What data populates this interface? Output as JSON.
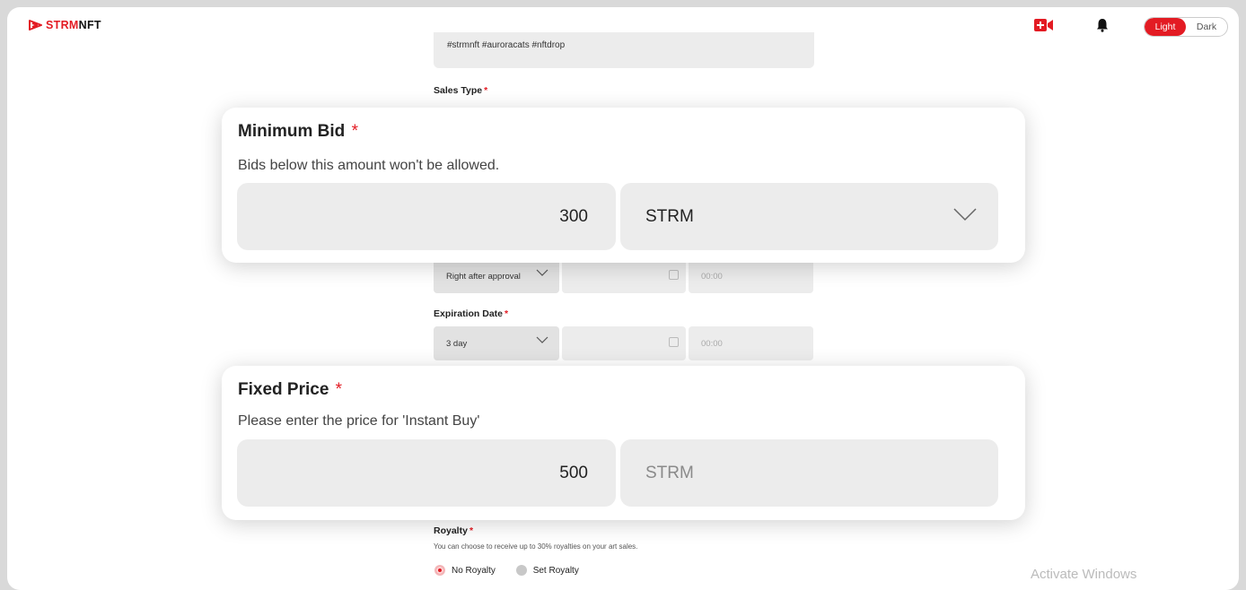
{
  "header": {
    "logo_text_a": "STRM",
    "logo_text_b": "NFT",
    "theme_light": "Light",
    "theme_dark": "Dark"
  },
  "form": {
    "tags_value": "#strmnft #auroracats #nftdrop",
    "sales_type_label": "Sales Type",
    "start_select": "Right after approval",
    "start_time": "00:00",
    "expiration_label": "Expiration Date",
    "expiration_select": "3 day",
    "expiration_time": "00:00",
    "royalty_label": "Royalty",
    "royalty_desc": "You can choose to receive up to 30% royalties on your art sales.",
    "royalty_options": [
      "No Royalty",
      "Set Royalty"
    ],
    "royalty_selected": "No Royalty"
  },
  "minimum_bid": {
    "title": "Minimum Bid",
    "required": "*",
    "description": "Bids below this amount won't be allowed.",
    "amount": "300",
    "currency": "STRM"
  },
  "fixed_price": {
    "title": "Fixed Price",
    "required": "*",
    "description": "Please enter the price for 'Instant Buy'",
    "amount": "500",
    "currency": "STRM"
  },
  "watermark": "Activate Windows",
  "colors": {
    "accent": "#e31b23",
    "field_bg": "#ececec"
  },
  "icons": [
    "logo-play-icon",
    "video-add-icon",
    "bell-icon",
    "chevron-down-icon",
    "calendar-icon"
  ]
}
